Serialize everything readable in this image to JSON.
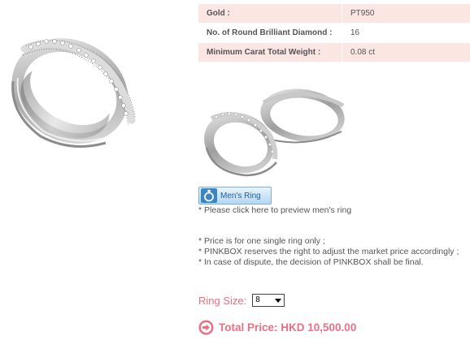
{
  "specs": [
    {
      "label": "Gold :",
      "value": "PT950",
      "shaded": true
    },
    {
      "label": "No. of Round Brilliant Diamond :",
      "value": "16",
      "shaded": false
    },
    {
      "label": "Minimum Carat Total Weight :",
      "value": "0.08 ct",
      "shaded": true
    }
  ],
  "mens_ring": {
    "button_label": "Men's Ring",
    "icon": "ring-icon",
    "note": "* Please click here to preview men's ring"
  },
  "notes": [
    "* Price is for one single ring only ;",
    "* PINKBOX reserves the right to adjust the market price accordingly ;",
    "* In case of dispute, the decision of PINKBOX shall be final."
  ],
  "ring_size": {
    "label": "Ring Size:",
    "selected": "8"
  },
  "price": {
    "text": "Total Price: HKD 10,500.00",
    "icon": "arrow-right-circle-icon"
  },
  "colors": {
    "accent": "#ea6f83",
    "table_shade": "#fbe6e4",
    "button_blue": "#b4d7f1"
  }
}
